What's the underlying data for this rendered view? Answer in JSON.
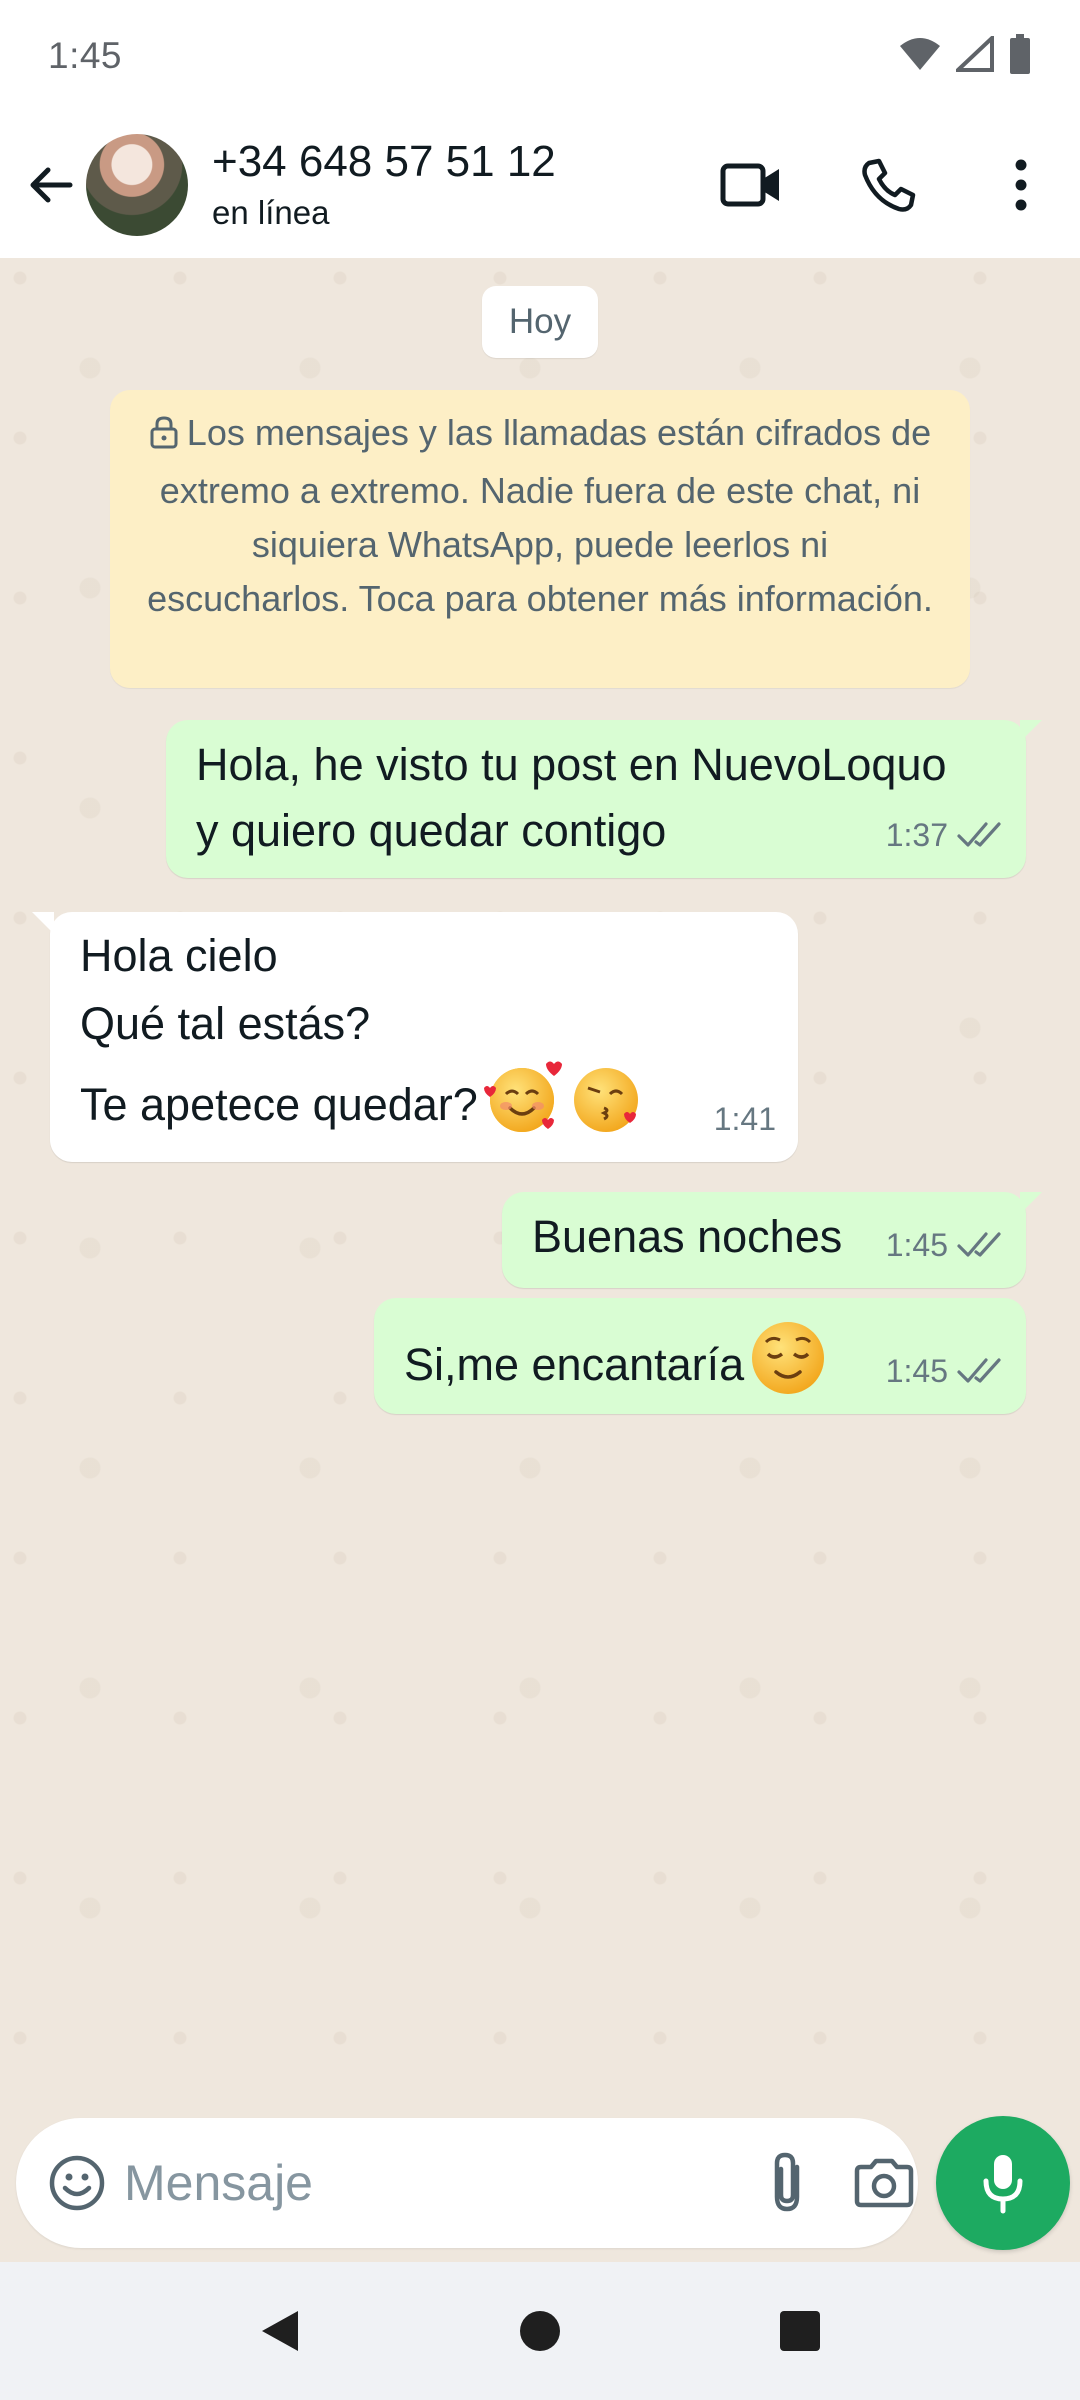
{
  "status_bar": {
    "time": "1:45",
    "icons": [
      "wifi-icon",
      "signal-icon",
      "battery-icon"
    ]
  },
  "header": {
    "contact_name": "+34 648 57 51 12",
    "contact_status": "en línea",
    "actions": [
      "video-call-icon",
      "phone-icon",
      "more-options-icon"
    ]
  },
  "chat": {
    "date_chip": "Hoy",
    "encryption_notice": "Los mensajes y las llamadas están cifrados de extremo a extremo. Nadie fuera de este chat, ni siquiera WhatsApp, puede leerlos ni escucharlos. Toca para obtener más información.",
    "messages": [
      {
        "direction": "out",
        "text": "Hola, he visto tu post en NuevoLoquo\ny quiero quedar contigo",
        "time": "1:37",
        "status": "read"
      },
      {
        "direction": "in",
        "text": "Hola cielo\nQué tal estás?\nTe apetece quedar?",
        "emojis": [
          "smiling-face-with-hearts",
          "face-blowing-kiss"
        ],
        "time": "1:41"
      },
      {
        "direction": "out",
        "text": "Buenas noches",
        "time": "1:45",
        "status": "read"
      },
      {
        "direction": "out",
        "text": "Si,me encantaría",
        "emojis": [
          "relieved-face"
        ],
        "time": "1:45",
        "status": "read"
      }
    ]
  },
  "input": {
    "placeholder": "Mensaje",
    "value": ""
  },
  "colors": {
    "outgoing_bubble": "#d9fdd3",
    "incoming_bubble": "#ffffff",
    "notice_bg": "#fdefc6",
    "accent_green": "#1daa61",
    "read_ticks": "#667781",
    "chat_bg": "#efe7dd"
  }
}
